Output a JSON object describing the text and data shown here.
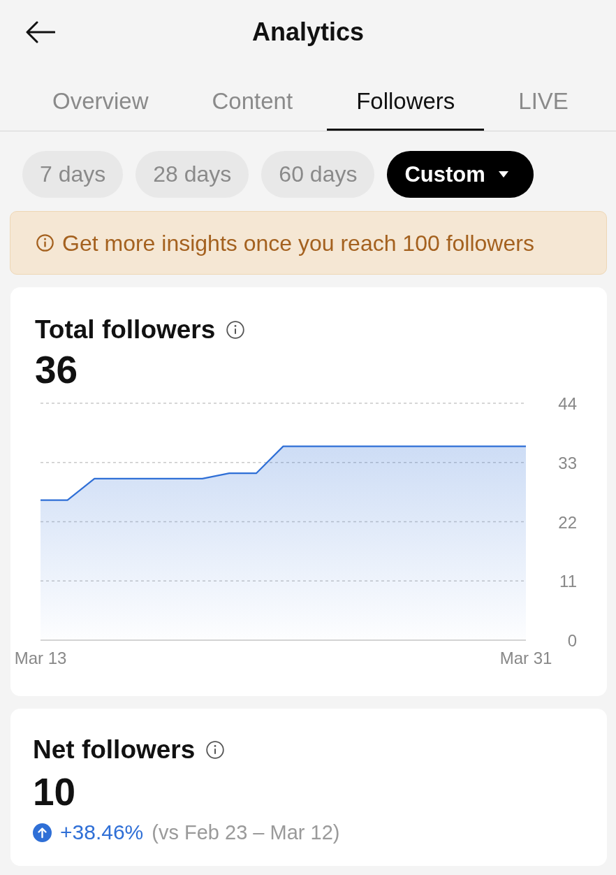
{
  "header": {
    "title": "Analytics"
  },
  "tabs": [
    {
      "label": "Overview",
      "selected": false
    },
    {
      "label": "Content",
      "selected": false
    },
    {
      "label": "Followers",
      "selected": true
    },
    {
      "label": "LIVE",
      "selected": false
    }
  ],
  "date_ranges": [
    {
      "label": "7 days",
      "kind": "preset",
      "selected": false
    },
    {
      "label": "28 days",
      "kind": "preset",
      "selected": false
    },
    {
      "label": "60 days",
      "kind": "preset",
      "selected": false
    },
    {
      "label": "Custom",
      "kind": "dropdown",
      "selected": true
    }
  ],
  "notice": {
    "text": "Get more insights once you reach 100 followers"
  },
  "total_followers": {
    "title": "Total followers",
    "value": "36",
    "chart_data": {
      "type": "area",
      "grid": true,
      "categories": [
        "Mar 13",
        null,
        null,
        null,
        null,
        null,
        null,
        null,
        null,
        null,
        null,
        null,
        null,
        null,
        null,
        null,
        null,
        null,
        "Mar 31"
      ],
      "values": [
        26,
        26,
        30,
        30,
        30,
        30,
        30,
        31,
        31,
        36,
        36,
        36,
        36,
        36,
        36,
        36,
        36,
        36,
        36
      ],
      "ylim": [
        0,
        44
      ],
      "yticks": [
        0,
        11,
        22,
        33,
        44
      ]
    }
  },
  "net_followers": {
    "title": "Net followers",
    "value": "10",
    "change": {
      "increase": true,
      "percent": "+38.46%",
      "comparison": "(vs Feb 23 – Mar 12)"
    }
  }
}
